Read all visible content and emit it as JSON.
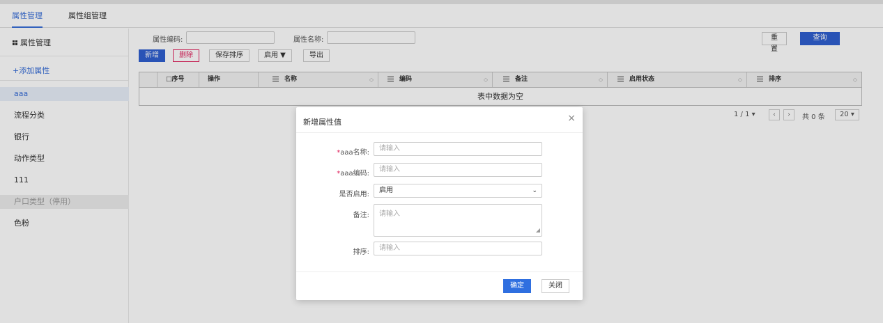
{
  "tabs": [
    {
      "label": "属性管理",
      "active": true
    },
    {
      "label": "属性组管理",
      "active": false
    }
  ],
  "sidebar": {
    "header": "属性管理",
    "add_label": "+添加属性",
    "items": [
      {
        "label": "aaa",
        "state": "selected"
      },
      {
        "label": "流程分类",
        "state": "normal"
      },
      {
        "label": "银行",
        "state": "normal"
      },
      {
        "label": "动作类型",
        "state": "normal"
      },
      {
        "label": "111",
        "state": "normal"
      },
      {
        "label": "户口类型（停用）",
        "state": "disabled"
      },
      {
        "label": "色粉",
        "state": "normal"
      }
    ]
  },
  "filters": {
    "code_label": "属性编码:",
    "code_value": "",
    "name_label": "属性名称:",
    "name_value": "",
    "reset_label": "重置",
    "query_label": "查询"
  },
  "toolbar": {
    "add_label": "新增",
    "delete_label": "删除",
    "save_sort_label": "保存排序",
    "enable_label": "启用 ▼",
    "export_label": "导出"
  },
  "table": {
    "columns": [
      "□序号",
      "操作",
      "名称",
      "编码",
      "备注",
      "启用状态",
      "排序"
    ],
    "empty_text": "表中数据为空"
  },
  "pager": {
    "page_info": "1 / 1 ▾",
    "prev": "‹",
    "next": "›",
    "total": "共 0 条",
    "page_size": "20 ▾"
  },
  "modal": {
    "title": "新增属性值",
    "close": "×",
    "fields": [
      {
        "label": "aaa名称:",
        "required": true,
        "placeholder": "请输入"
      },
      {
        "label": "aaa编码:",
        "required": true,
        "placeholder": "请输入"
      },
      {
        "label": "是否启用:",
        "required": false,
        "value": "启用"
      },
      {
        "label": "备注:",
        "required": false,
        "placeholder": "请输入"
      },
      {
        "label": "排序:",
        "required": false,
        "placeholder": "请输入"
      }
    ],
    "required_mark": "*",
    "confirm_label": "确定",
    "close_label": "关闭"
  },
  "colors": {
    "accent": "#3a6fd8",
    "primary_button": "#2f5fd0",
    "danger": "#e0245e"
  }
}
